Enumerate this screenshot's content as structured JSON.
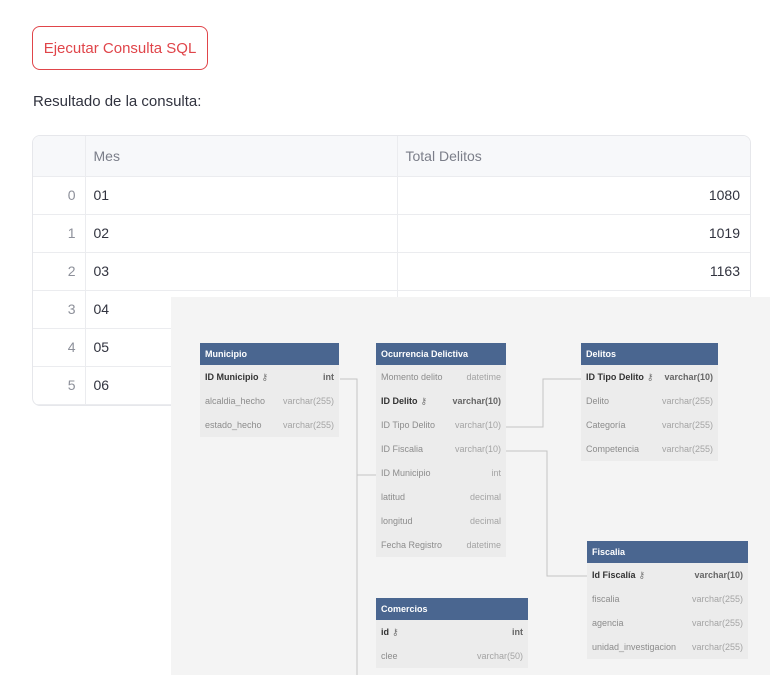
{
  "button": {
    "label": "Ejecutar Consulta SQL"
  },
  "result": {
    "label": "Resultado de la consulta:"
  },
  "table": {
    "columns": [
      "Mes",
      "Total Delitos"
    ],
    "rows": [
      {
        "idx": "0",
        "mes": "01",
        "total": "1080"
      },
      {
        "idx": "1",
        "mes": "02",
        "total": "1019"
      },
      {
        "idx": "2",
        "mes": "03",
        "total": "1163"
      },
      {
        "idx": "3",
        "mes": "04",
        "total": ""
      },
      {
        "idx": "4",
        "mes": "05",
        "total": ""
      },
      {
        "idx": "5",
        "mes": "06",
        "total": ""
      }
    ]
  },
  "diagram": {
    "municipio": {
      "title": "Municipio",
      "fields": [
        {
          "name": "ID Municipio",
          "type": "int",
          "pk": true
        },
        {
          "name": "alcaldia_hecho",
          "type": "varchar(255)"
        },
        {
          "name": "estado_hecho",
          "type": "varchar(255)"
        }
      ]
    },
    "ocurrencia": {
      "title": "Ocurrencia Delictiva",
      "fields": [
        {
          "name": "Momento delito",
          "type": "datetime"
        },
        {
          "name": "ID Delito",
          "type": "varchar(10)",
          "pk": true
        },
        {
          "name": "ID Tipo Delito",
          "type": "varchar(10)"
        },
        {
          "name": "ID Fiscalia",
          "type": "varchar(10)"
        },
        {
          "name": "ID Municipio",
          "type": "int"
        },
        {
          "name": "latitud",
          "type": "decimal"
        },
        {
          "name": "longitud",
          "type": "decimal"
        },
        {
          "name": "Fecha Registro",
          "type": "datetime"
        }
      ]
    },
    "delitos": {
      "title": "Delitos",
      "fields": [
        {
          "name": "ID Tipo Delito",
          "type": "varchar(10)",
          "pk": true
        },
        {
          "name": "Delito",
          "type": "varchar(255)"
        },
        {
          "name": "Categoría",
          "type": "varchar(255)"
        },
        {
          "name": "Competencia",
          "type": "varchar(255)"
        }
      ]
    },
    "fiscalia": {
      "title": "Fiscalia",
      "fields": [
        {
          "name": "Id Fiscalía",
          "type": "varchar(10)",
          "pk": true
        },
        {
          "name": "fiscalia",
          "type": "varchar(255)"
        },
        {
          "name": "agencia",
          "type": "varchar(255)"
        },
        {
          "name": "unidad_investigacion",
          "type": "varchar(255)"
        }
      ]
    },
    "comercios": {
      "title": "Comercios",
      "fields": [
        {
          "name": "id",
          "type": "int",
          "pk": true
        },
        {
          "name": "clee",
          "type": "varchar(50)"
        }
      ]
    }
  }
}
